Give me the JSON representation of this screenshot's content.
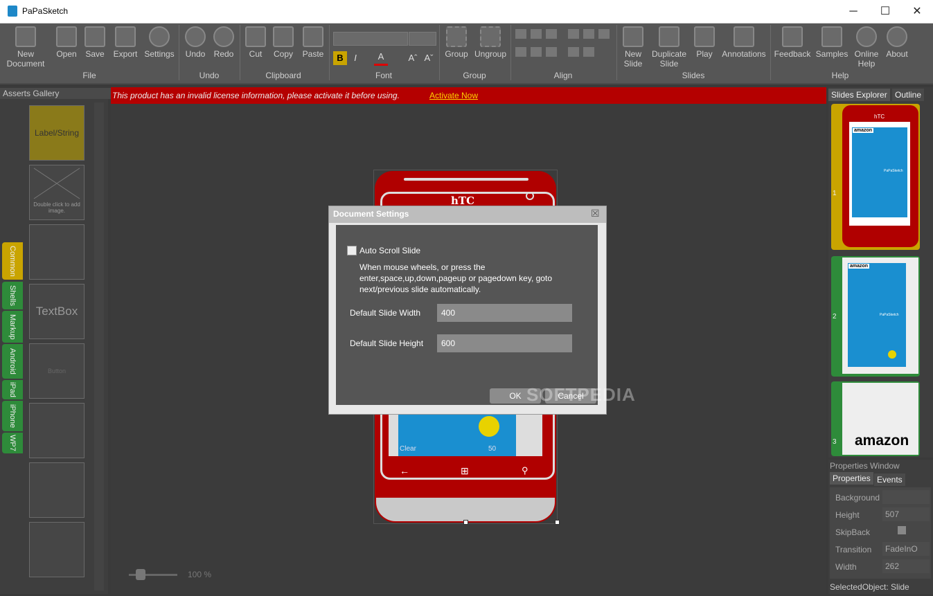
{
  "window": {
    "title": "PaPaSketch",
    "minimize": "─",
    "maximize": "☐",
    "close": "✕"
  },
  "ribbon": {
    "file": {
      "label": "File",
      "new": "New\nDocument",
      "open": "Open",
      "save": "Save",
      "export": "Export",
      "settings": "Settings"
    },
    "undo": {
      "label": "Undo",
      "undo": "Undo",
      "redo": "Redo"
    },
    "clipboard": {
      "label": "Clipboard",
      "cut": "Cut",
      "copy": "Copy",
      "paste": "Paste"
    },
    "font": {
      "label": "Font",
      "bold": "B",
      "italic": "I",
      "color": "A",
      "grow": "Aˆ",
      "shrink": "Aˇ"
    },
    "group": {
      "label": "Group",
      "group": "Group",
      "ungroup": "Ungroup"
    },
    "align": {
      "label": "Align"
    },
    "slides": {
      "label": "Slides",
      "new": "New\nSlide",
      "duplicate": "Duplicate\nSlide",
      "play": "Play",
      "annotations": "Annotations"
    },
    "help": {
      "label": "Help",
      "feedback": "Feedback",
      "samples": "Samples",
      "online": "Online\nHelp",
      "about": "About"
    }
  },
  "gallery": {
    "title": "Asserts Gallery",
    "tabs": [
      "Common",
      "Shells",
      "Markup",
      "Android",
      "iPad",
      "iPhone",
      "WP7"
    ],
    "items": [
      "Label/String",
      "Double click to add image.",
      "",
      "TextBox",
      "Button",
      "",
      "",
      ""
    ]
  },
  "license": {
    "message": "This product has an invalid license information, please activate it before using.",
    "action": "Activate Now"
  },
  "phone": {
    "brand": "hTC",
    "weather_label": "Clear",
    "weather_value": "50"
  },
  "zoom": {
    "value": "100 %"
  },
  "slides_panel": {
    "tab_explorer": "Slides Explorer",
    "tab_outline": "Outline",
    "slides": [
      {
        "num": "1",
        "text": "amazon"
      },
      {
        "num": "2",
        "text": "amazon"
      },
      {
        "num": "3",
        "text": "amazon"
      }
    ],
    "brand": "hTC",
    "papasketch_label": "PaPaSketch"
  },
  "properties": {
    "title": "Properties Window",
    "tab_properties": "Properties",
    "tab_events": "Events",
    "rows": [
      {
        "label": "Background",
        "value": ""
      },
      {
        "label": "Height",
        "value": "507"
      },
      {
        "label": "SkipBack",
        "value": ""
      },
      {
        "label": "Transition",
        "value": "FadeInO"
      },
      {
        "label": "Width",
        "value": "262"
      }
    ],
    "selected": "SelectedObject: Slide"
  },
  "dialog": {
    "title": "Document Settings",
    "close": "☒",
    "auto_scroll_label": "Auto Scroll Slide",
    "description": "When mouse wheels, or press the enter,space,up,down,pageup or pagedown key, goto next/previous slide automatically.",
    "width_label": "Default Slide Width",
    "width_value": "400",
    "height_label": "Default Slide Height",
    "height_value": "600",
    "ok": "OK",
    "cancel": "Cancel"
  },
  "watermark": "SOFTPEDIA",
  "colors": {
    "license_bar": "#b40000",
    "phone_red": "#b00000",
    "tile_blue": "#1a8fd0",
    "tab_yellow": "#c9a400",
    "tab_green": "#2e8b3a"
  }
}
